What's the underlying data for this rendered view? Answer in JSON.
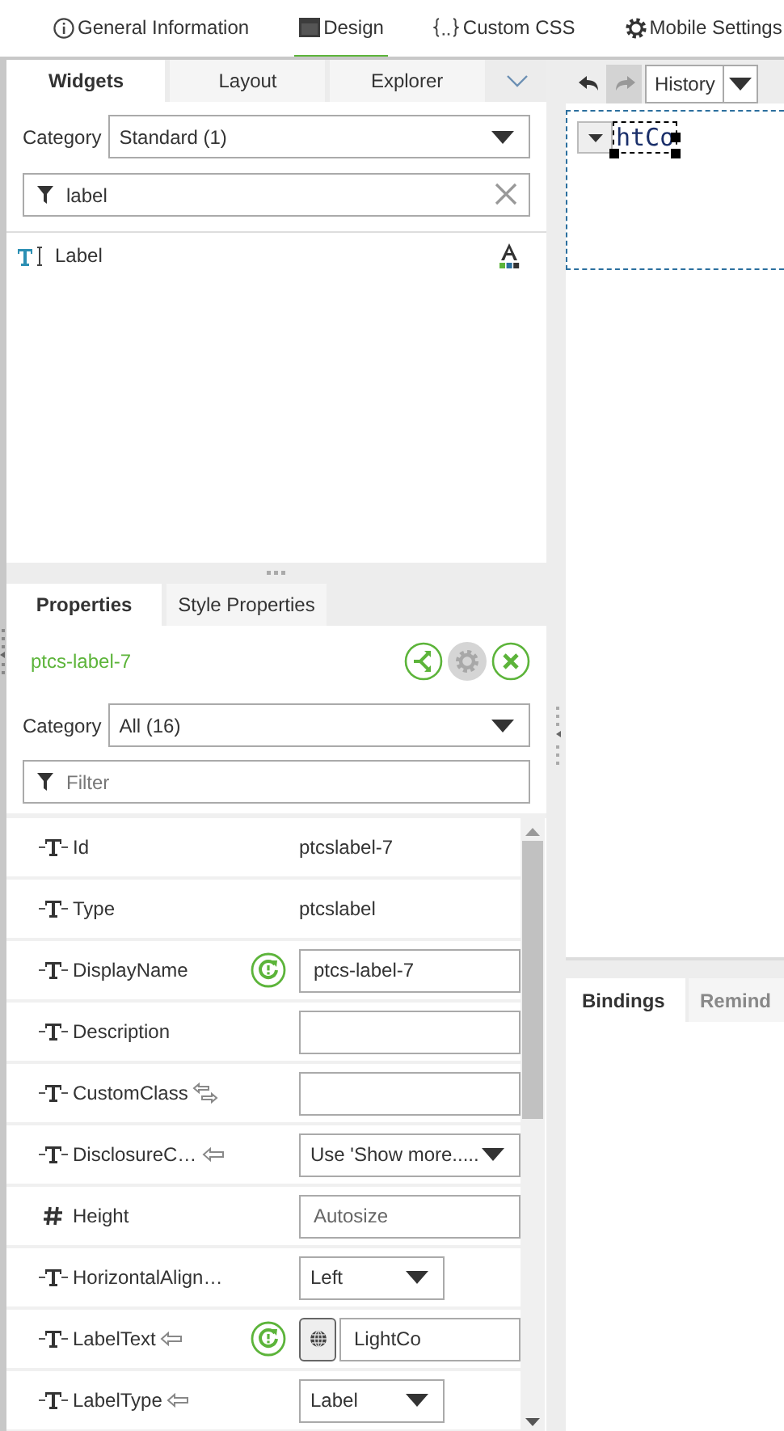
{
  "top_tabs": [
    {
      "label": "General Information",
      "selected": false
    },
    {
      "label": "Design",
      "selected": true
    },
    {
      "label": "Custom CSS",
      "selected": false
    },
    {
      "label": "Mobile Settings",
      "selected": false
    }
  ],
  "widgets_panel": {
    "tabs": [
      {
        "label": "Widgets",
        "selected": true
      },
      {
        "label": "Layout",
        "selected": false
      },
      {
        "label": "Explorer",
        "selected": false
      }
    ],
    "category_label": "Category",
    "category_value": "Standard (1)",
    "filter": {
      "value": "label"
    },
    "items": [
      {
        "label": "Label"
      }
    ]
  },
  "properties_panel": {
    "tabs": [
      {
        "label": "Properties",
        "selected": true
      },
      {
        "label": "Style Properties",
        "selected": false
      }
    ],
    "widget_name": "ptcs-label-7",
    "category_label": "Category",
    "category_value": "All (16)",
    "filter": {
      "placeholder": "Filter"
    },
    "rows": [
      {
        "name": "Id",
        "kind": "string",
        "resettable": false,
        "field": {
          "kind": "text",
          "value": "ptcslabel-7"
        }
      },
      {
        "name": "Type",
        "kind": "string",
        "resettable": false,
        "field": {
          "kind": "text",
          "value": "ptcslabel"
        }
      },
      {
        "name": "DisplayName",
        "kind": "string",
        "resettable": true,
        "field": {
          "kind": "input",
          "value": "ptcs-label-7"
        }
      },
      {
        "name": "Description",
        "kind": "string",
        "resettable": false,
        "field": {
          "kind": "input"
        }
      },
      {
        "name": "CustomClass",
        "kind": "string",
        "binding": {
          "kind": "inout"
        },
        "resettable": false,
        "field": {
          "kind": "input"
        }
      },
      {
        "name": "DisclosureC…",
        "kind": "string",
        "binding": {
          "kind": "in"
        },
        "resettable": false,
        "field": {
          "kind": "select",
          "compact": false,
          "value": "Use 'Show more....."
        }
      },
      {
        "name": "Height",
        "kind": "number",
        "resettable": false,
        "field": {
          "kind": "input",
          "placeholder": "Autosize"
        }
      },
      {
        "name": "HorizontalAlign…",
        "kind": "string",
        "resettable": false,
        "field": {
          "kind": "select",
          "compact": true,
          "value": "Left"
        }
      },
      {
        "name": "LabelText",
        "kind": "string",
        "binding": {
          "kind": "in"
        },
        "resettable": true,
        "field": {
          "kind": "input",
          "localizable": true,
          "value": "LightCo"
        }
      },
      {
        "name": "LabelType",
        "kind": "string",
        "binding": {
          "kind": "in"
        },
        "resettable": false,
        "field": {
          "kind": "select",
          "compact": true,
          "value": "Label"
        }
      }
    ]
  },
  "canvas": {
    "history": "History",
    "redo_disabled": true,
    "widget_text": "htCo"
  },
  "bottom_tabs": [
    {
      "label": "Bindings",
      "selected": true
    },
    {
      "label": "Remind",
      "selected": false
    }
  ]
}
